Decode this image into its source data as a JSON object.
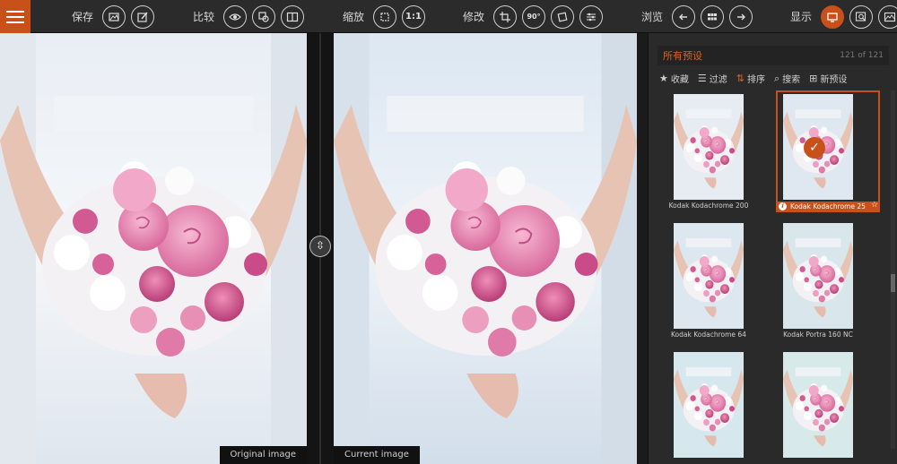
{
  "toolbar": {
    "groups": [
      {
        "label": "保存",
        "buttons": [
          "save-image-icon",
          "save-edit-icon"
        ]
      },
      {
        "label": "比较",
        "buttons": [
          "eye-icon",
          "compare-overlay-icon",
          "split-compare-icon"
        ]
      },
      {
        "label": "缩放",
        "buttons": [
          "zoom-fit-icon",
          "zoom-1to1-icon"
        ],
        "zoom_1to1_text": "1:1"
      },
      {
        "label": "修改",
        "buttons": [
          "crop-icon",
          "rotate-90-icon",
          "straighten-icon",
          "adjust-sliders-icon"
        ],
        "rotate_text": "90°"
      },
      {
        "label": "浏览",
        "buttons": [
          "prev-arrow-icon",
          "grid-view-icon",
          "next-arrow-icon"
        ]
      },
      {
        "label": "显示",
        "buttons": [
          "display-monitor-icon",
          "loupe-icon",
          "histogram-icon"
        ]
      }
    ],
    "accent": "#c8511a"
  },
  "panes": {
    "left_caption": "Original image",
    "right_caption": "Current image"
  },
  "panel": {
    "title": "所有预设",
    "count": "121 of 121",
    "actions": [
      {
        "icon": "star-icon",
        "label": "收藏"
      },
      {
        "icon": "list-icon",
        "label": "过滤"
      },
      {
        "icon": "sort-icon",
        "label": "排序"
      },
      {
        "icon": "search-icon",
        "label": "搜索"
      },
      {
        "icon": "new-preset-icon",
        "label": "新预设"
      }
    ],
    "presets": [
      {
        "name": "Kodak Kodachrome 200",
        "selected": false
      },
      {
        "name": "Kodak Kodachrome 25",
        "selected": true
      },
      {
        "name": "Kodak Kodachrome 64",
        "selected": false
      },
      {
        "name": "Kodak Portra 160 NC",
        "selected": false
      },
      {
        "name": "",
        "selected": false
      },
      {
        "name": "",
        "selected": false
      }
    ]
  }
}
